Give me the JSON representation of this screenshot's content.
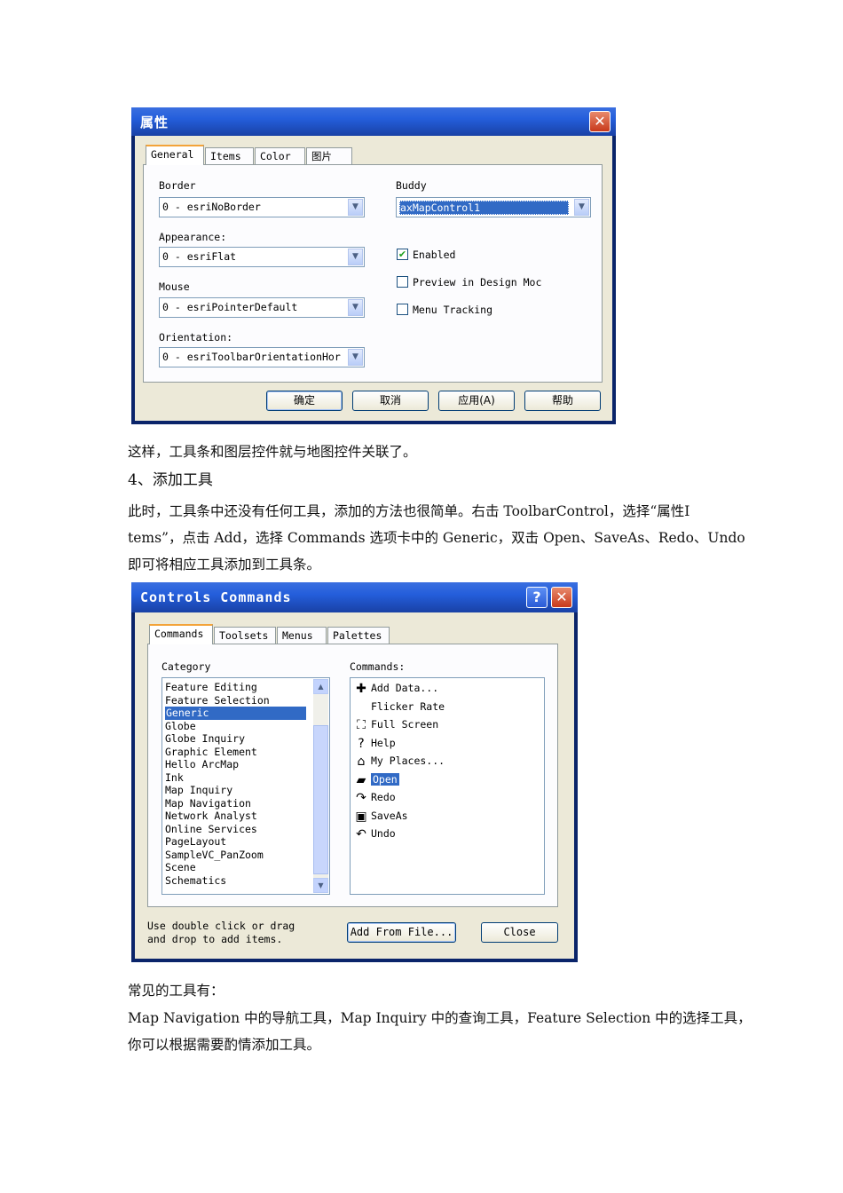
{
  "dialog1": {
    "title": "属性",
    "tabs": [
      "General",
      "Items",
      "Color",
      "图片"
    ],
    "labels": {
      "border": "Border",
      "appearance": "Appearance:",
      "mouse": "Mouse",
      "orientation": "Orientation:",
      "buddy": "Buddy"
    },
    "values": {
      "border": "0 - esriNoBorder",
      "appearance": "0 - esriFlat",
      "mouse": "0 - esriPointerDefault",
      "orientation": "0 - esriToolbarOrientationHor",
      "buddy": "axMapControl1"
    },
    "checkboxes": [
      {
        "label": "Enabled",
        "checked": true
      },
      {
        "label": "Preview in Design Moc",
        "checked": false
      },
      {
        "label": "Menu Tracking",
        "checked": false
      }
    ],
    "buttons": [
      "确定",
      "取消",
      "应用(A)",
      "帮助"
    ]
  },
  "text": {
    "para1": "这样，工具条和图层控件就与地图控件关联了。",
    "heading": "4、添加工具",
    "para2_line1": "此时，工具条中还没有任何工具，添加的方法也很简单。右击 ToolbarControl，选择“属性I",
    "para2_line2": "tems”，点击 Add，选择 Commands 选项卡中的 Generic，双击 Open、SaveAs、Redo、Undo",
    "para2_line3": "即可将相应工具添加到工具条。",
    "para3": "常见的工具有：",
    "para4_line1": "Map Navigation 中的导航工具，Map Inquiry 中的查询工具，Feature Selection 中的选择工具，",
    "para4_line2": "你可以根据需要酌情添加工具。"
  },
  "dialog2": {
    "title": "Controls Commands",
    "tabs": [
      "Commands",
      "Toolsets",
      "Menus",
      "Palettes"
    ],
    "category_label": "Category",
    "commands_label": "Commands:",
    "categories": [
      "Feature Editing",
      "Feature Selection",
      "Generic",
      "Globe",
      "Globe Inquiry",
      "Graphic Element",
      "Hello ArcMap",
      "Ink",
      "Map Inquiry",
      "Map Navigation",
      "Network Analyst",
      "Online Services",
      "PageLayout",
      "SampleVC_PanZoom",
      "Scene",
      "Schematics"
    ],
    "selected_category": "Generic",
    "commands": [
      {
        "label": "Add Data...",
        "icon": "add-data-icon",
        "glyph": "✚"
      },
      {
        "label": "Flicker Rate",
        "icon": "",
        "glyph": ""
      },
      {
        "label": "Full Screen",
        "icon": "full-screen-icon",
        "glyph": "⛶"
      },
      {
        "label": "Help",
        "icon": "help-arrow-icon",
        "glyph": "?"
      },
      {
        "label": "My Places...",
        "icon": "my-places-icon",
        "glyph": "⌂"
      },
      {
        "label": "Open",
        "icon": "open-folder-icon",
        "glyph": "▰"
      },
      {
        "label": "Redo",
        "icon": "redo-icon",
        "glyph": "↷"
      },
      {
        "label": "SaveAs",
        "icon": "save-icon",
        "glyph": "▣"
      },
      {
        "label": "Undo",
        "icon": "undo-icon",
        "glyph": "↶"
      }
    ],
    "selected_command": "Open",
    "hint": [
      "Use double click or drag",
      "and drop to add items."
    ],
    "add_from_file": "Add From File...",
    "close": "Close"
  },
  "colors": {
    "titlebar": "#245edb",
    "selection": "#316ac5",
    "face": "#ece9d8"
  }
}
